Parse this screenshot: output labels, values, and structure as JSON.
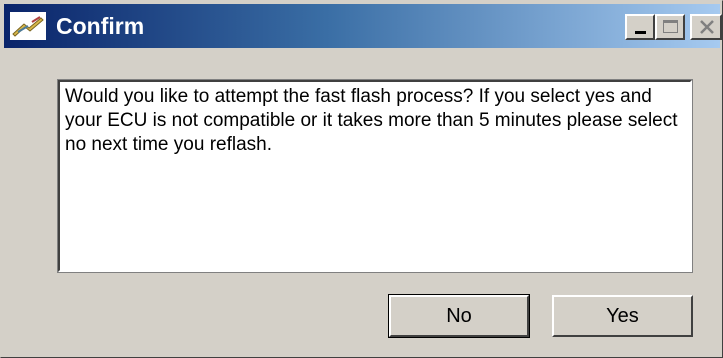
{
  "window": {
    "title": "Confirm",
    "icon": "flash-icon",
    "controls": {
      "minimize": "minimize-icon",
      "maximize": "maximize-icon",
      "close": "close-icon"
    }
  },
  "message": {
    "text": "Would you like to attempt the fast flash process? If you select yes and your ECU is not compatible or it takes more than 5 minutes please select no next time you reflash."
  },
  "buttons": {
    "no_label": "No",
    "yes_label": "Yes"
  },
  "colors": {
    "titlebar_start": "#0a246a",
    "titlebar_end": "#a6caf0",
    "face": "#d4d0c8"
  }
}
